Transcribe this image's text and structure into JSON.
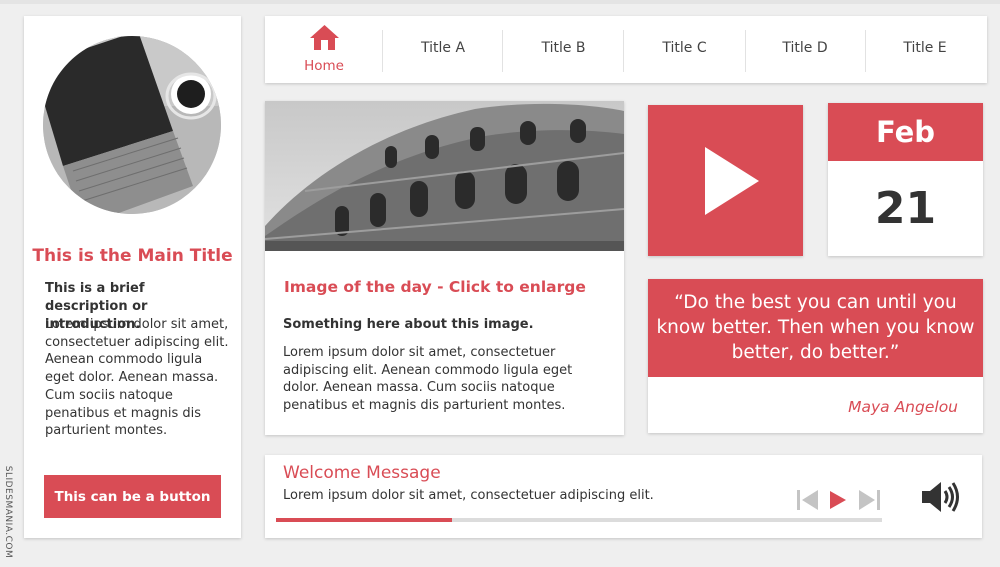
{
  "profile": {
    "main_title": "This is the Main Title",
    "intro_bold": "This is a brief description or introduction.",
    "intro_text": "Lorem ipsum dolor sit amet, consectetuer adipiscing elit. Aenean commodo ligula eget dolor. Aenean massa. Cum sociis natoque penatibus et magnis dis parturient montes.",
    "button_label": "This can be a button",
    "avatar_image": "laptop-and-coffee-photo"
  },
  "nav": {
    "home_label": "Home",
    "home_icon": "home-icon",
    "items": [
      {
        "label": "Title A"
      },
      {
        "label": "Title B"
      },
      {
        "label": "Title C"
      },
      {
        "label": "Title D"
      },
      {
        "label": "Title E"
      }
    ]
  },
  "image_card": {
    "image": "colosseum-photo",
    "title": "Image of the day - Click to enlarge",
    "bold": "Something here about this image.",
    "text": "Lorem ipsum dolor sit amet, consectetuer adipiscing elit. Aenean commodo ligula eget dolor. Aenean massa. Cum sociis natoque penatibus et magnis dis parturient montes."
  },
  "video": {
    "icon": "play-icon"
  },
  "date": {
    "month": "Feb",
    "day": "21"
  },
  "quote": {
    "text": "“Do the best you can until you know better. Then when you know better, do better.”",
    "author": "Maya Angelou"
  },
  "welcome": {
    "title": "Welcome Message",
    "text": "Lorem ipsum dolor sit amet, consectetuer adipiscing elit.",
    "progress_percent": 29
  },
  "player": {
    "prev_icon": "skip-back-icon",
    "play_icon": "play-icon",
    "next_icon": "skip-forward-icon",
    "volume_icon": "volume-icon"
  },
  "watermark": "SLIDESMANIA.COM",
  "colors": {
    "accent": "#d94c55",
    "background": "#efefef",
    "card": "#ffffff",
    "text": "#333333"
  }
}
